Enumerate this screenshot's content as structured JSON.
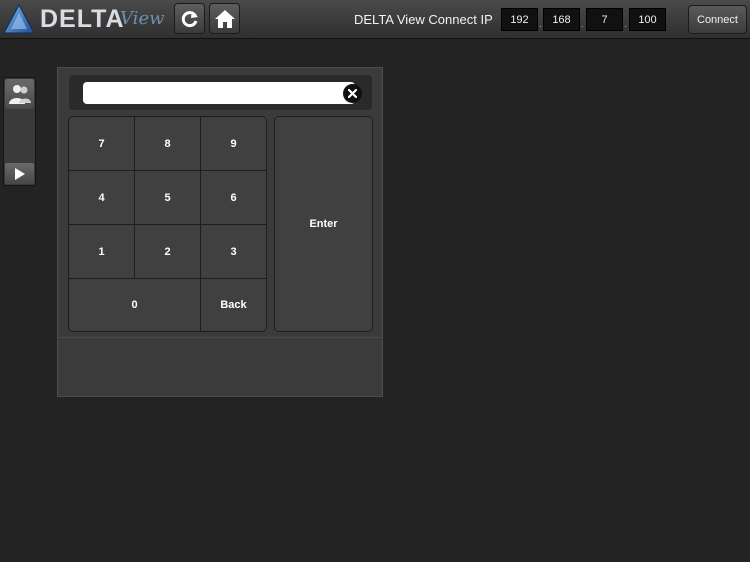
{
  "header": {
    "brand": "DELTA",
    "brand_sub": "View",
    "connect_label": "DELTA View Connect IP",
    "ip": [
      "192",
      "168",
      "7",
      "100"
    ],
    "ip_separator": ".",
    "connect_button": "Connect"
  },
  "icons": {
    "logo": "delta-triangle-logo",
    "refresh": "refresh-icon",
    "home": "home-icon",
    "users": "users-icon",
    "play": "play-icon",
    "clear": "clear-icon"
  },
  "keypad": {
    "input_value": "",
    "keys": [
      "7",
      "8",
      "9",
      "4",
      "5",
      "6",
      "1",
      "2",
      "3"
    ],
    "zero": "0",
    "back": "Back",
    "enter": "Enter"
  },
  "colors": {
    "background": "#232323",
    "panel": "#3b3b3b",
    "key": "#404040",
    "logo_blue": "#2b6cb8"
  }
}
